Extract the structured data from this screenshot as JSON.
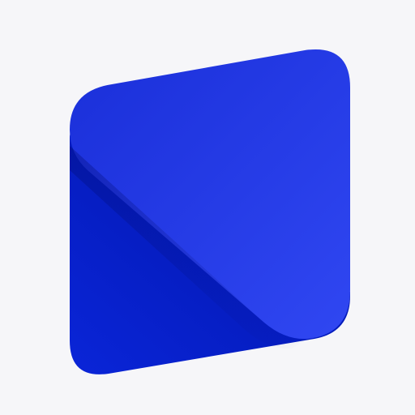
{
  "icon": {
    "name": "app-logo-icon",
    "colors": {
      "background": "#f6f6f9",
      "front_light": "#3047f2",
      "front_dark": "#1a2fd9",
      "back_light": "#0a25d8",
      "back_dark": "#0014a6"
    }
  }
}
